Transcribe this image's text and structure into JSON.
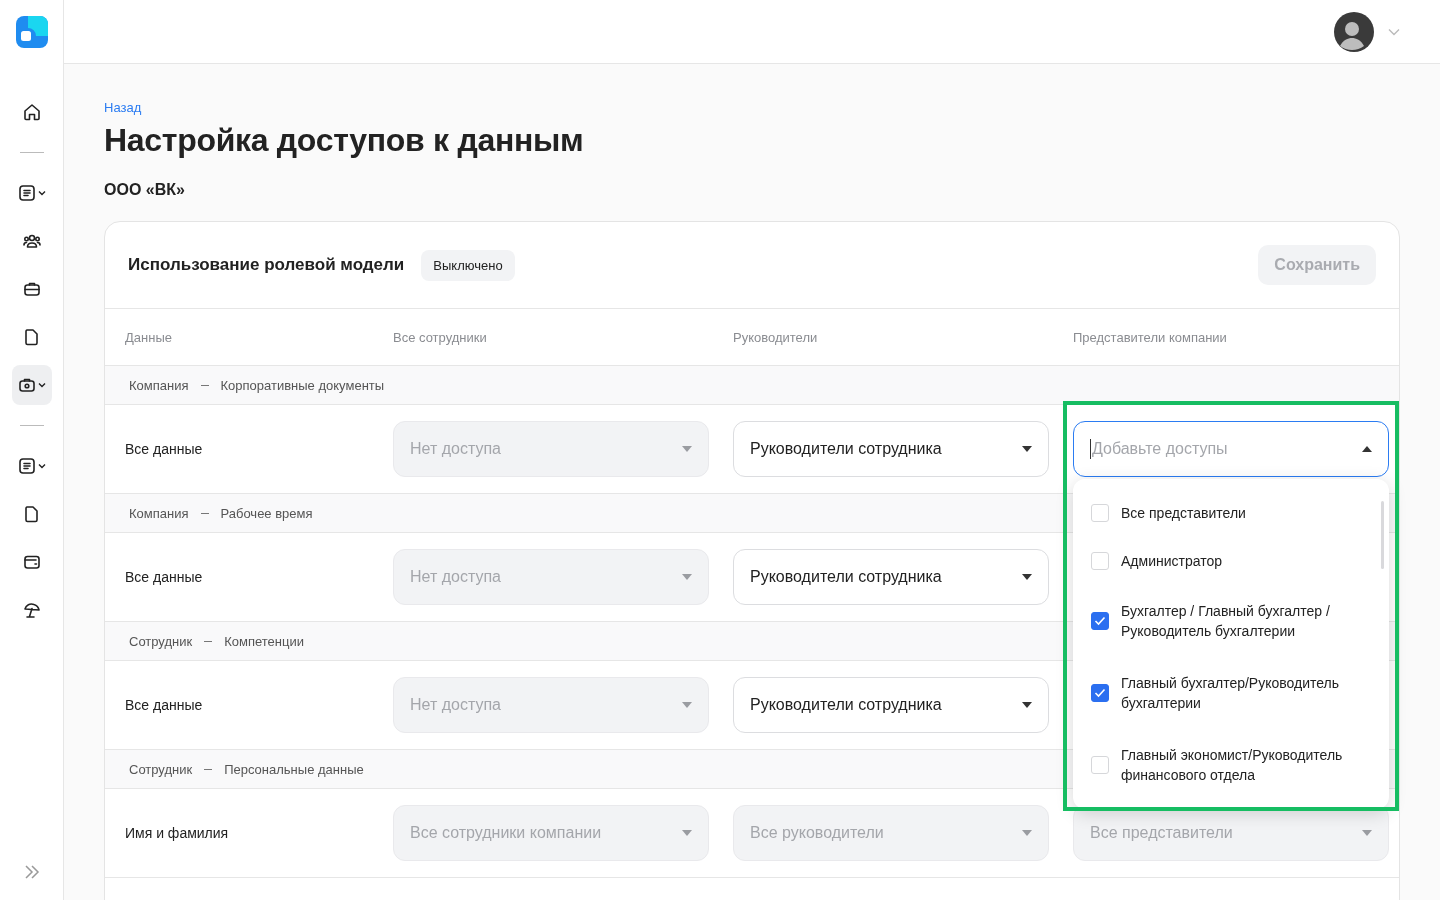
{
  "sidebar": {
    "groups": [
      [
        {
          "selected": false,
          "has_menu": false
        }
      ],
      [
        {
          "selected": false,
          "has_menu": true
        },
        {
          "selected": false,
          "has_menu": false
        },
        {
          "selected": false,
          "has_menu": false
        },
        {
          "selected": false,
          "has_menu": false
        },
        {
          "selected": true,
          "has_menu": true
        }
      ],
      [
        {
          "selected": false,
          "has_menu": true
        },
        {
          "selected": false,
          "has_menu": false
        },
        {
          "selected": false,
          "has_menu": false
        },
        {
          "selected": false,
          "has_menu": false
        }
      ]
    ]
  },
  "back_link": "Назад",
  "title": "Настройка доступов к данным",
  "company": "ООО «ВК»",
  "card": {
    "title": "Использование ролевой модели",
    "status": "Выключено",
    "save_button": {
      "label": "Сохранить",
      "disabled": true
    }
  },
  "table": {
    "columns": [
      "Данные",
      "Все сотрудники",
      "Руководители",
      "Представители компании"
    ],
    "groups": [
      {
        "category": "Компания",
        "section": "Корпоративные документы",
        "rows": [
          {
            "label": "Все данные",
            "cells": [
              {
                "value": "Нет доступа",
                "disabled": true
              },
              {
                "value": "Руководители сотрудника",
                "disabled": false
              },
              {
                "placeholder": "Добавьте доступы",
                "disabled": false,
                "expanded": true
              }
            ]
          }
        ]
      },
      {
        "category": "Компания",
        "section": "Рабочее время",
        "rows": [
          {
            "label": "Все данные",
            "cells": [
              {
                "value": "Нет доступа",
                "disabled": true
              },
              {
                "value": "Руководители сотрудника",
                "disabled": false
              }
            ]
          }
        ]
      },
      {
        "category": "Сотрудник",
        "section": "Компетенции",
        "rows": [
          {
            "label": "Все данные",
            "cells": [
              {
                "value": "Нет доступа",
                "disabled": true
              },
              {
                "value": "Руководители сотрудника",
                "disabled": false
              }
            ]
          }
        ]
      },
      {
        "category": "Сотрудник",
        "section": "Персональные данные",
        "rows": [
          {
            "label": "Имя и фамилия",
            "cells": [
              {
                "value": "Все сотрудники компании",
                "disabled": true
              },
              {
                "value": "Все руководители",
                "disabled": true
              },
              {
                "value": "Все представители",
                "disabled": true
              }
            ]
          }
        ]
      }
    ]
  },
  "dropdown": {
    "highlighted": true,
    "options": [
      {
        "label": "Все представители",
        "checked": false
      },
      {
        "label": "Администратор",
        "checked": false
      },
      {
        "label": "Бухгалтер / Главный бухгалтер / Руководитель бухгалтерии",
        "checked": true
      },
      {
        "label": "Главный бухгалтер/Руководитель бухгалтерии",
        "checked": true
      },
      {
        "label": "Главный экономист/Руководитель финансового отдела",
        "checked": false
      }
    ]
  }
}
